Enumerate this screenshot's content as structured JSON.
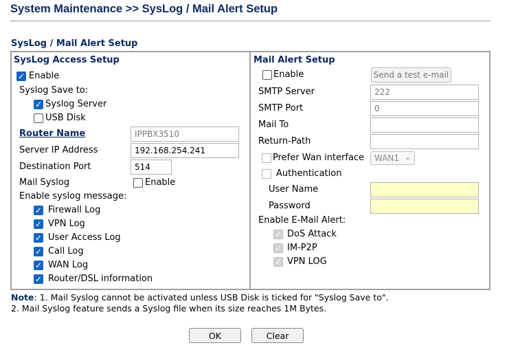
{
  "page": {
    "title": "System Maintenance >> SysLog / Mail Alert Setup",
    "section_title": "SysLog / Mail Alert Setup"
  },
  "syslog": {
    "title": "SysLog Access Setup",
    "enable_label": "Enable",
    "enable_checked": true,
    "save_to_label": "Syslog Save to:",
    "syslog_server_label": "Syslog Server",
    "syslog_server_checked": true,
    "usb_disk_label": "USB Disk",
    "usb_disk_checked": false,
    "router_name_label": "Router Name",
    "router_name_value": "IPPBX3510",
    "server_ip_label": "Server IP Address",
    "server_ip_value": "192.168.254.241",
    "dest_port_label": "Destination Port",
    "dest_port_value": "514",
    "mail_syslog_label": "Mail Syslog",
    "mail_syslog_enable_label": "Enable",
    "mail_syslog_checked": false,
    "messages_label": "Enable syslog message:",
    "messages": [
      {
        "label": "Firewall Log",
        "checked": true
      },
      {
        "label": "VPN Log",
        "checked": true
      },
      {
        "label": "User Access Log",
        "checked": true
      },
      {
        "label": "Call Log",
        "checked": true
      },
      {
        "label": "WAN Log",
        "checked": true
      },
      {
        "label": "Router/DSL information",
        "checked": true
      }
    ]
  },
  "mail": {
    "title": "Mail Alert Setup",
    "enable_label": "Enable",
    "enable_checked": false,
    "test_button_label": "Send a test e-mail",
    "smtp_server_label": "SMTP Server",
    "smtp_server_value": "222",
    "smtp_port_label": "SMTP Port",
    "smtp_port_value": "0",
    "mail_to_label": "Mail To",
    "mail_to_value": "",
    "return_path_label": "Return-Path",
    "return_path_value": "",
    "prefer_wan_label": "Prefer Wan interface",
    "prefer_wan_value": "WAN1",
    "auth_label": "Authentication",
    "username_label": "User Name",
    "username_value": "",
    "password_label": "Password",
    "password_value": "",
    "alert_label": "Enable E-Mail Alert:",
    "alerts": [
      {
        "label": "DoS Attack",
        "checked": true
      },
      {
        "label": "IM-P2P",
        "checked": true
      },
      {
        "label": "VPN LOG",
        "checked": true
      }
    ]
  },
  "note": {
    "prefix": "Note",
    "line1": ": 1. Mail Syslog cannot be activated unless USB Disk is ticked for \"Syslog Save to\".",
    "line2": "2. Mail Syslog feature sends a Syslog file when its size reaches 1M Bytes."
  },
  "buttons": {
    "ok": "OK",
    "clear": "Clear"
  },
  "colors": {
    "heading": "#0d2b63",
    "checkbox": "#1565c0",
    "required_field": "#ffffc8"
  }
}
